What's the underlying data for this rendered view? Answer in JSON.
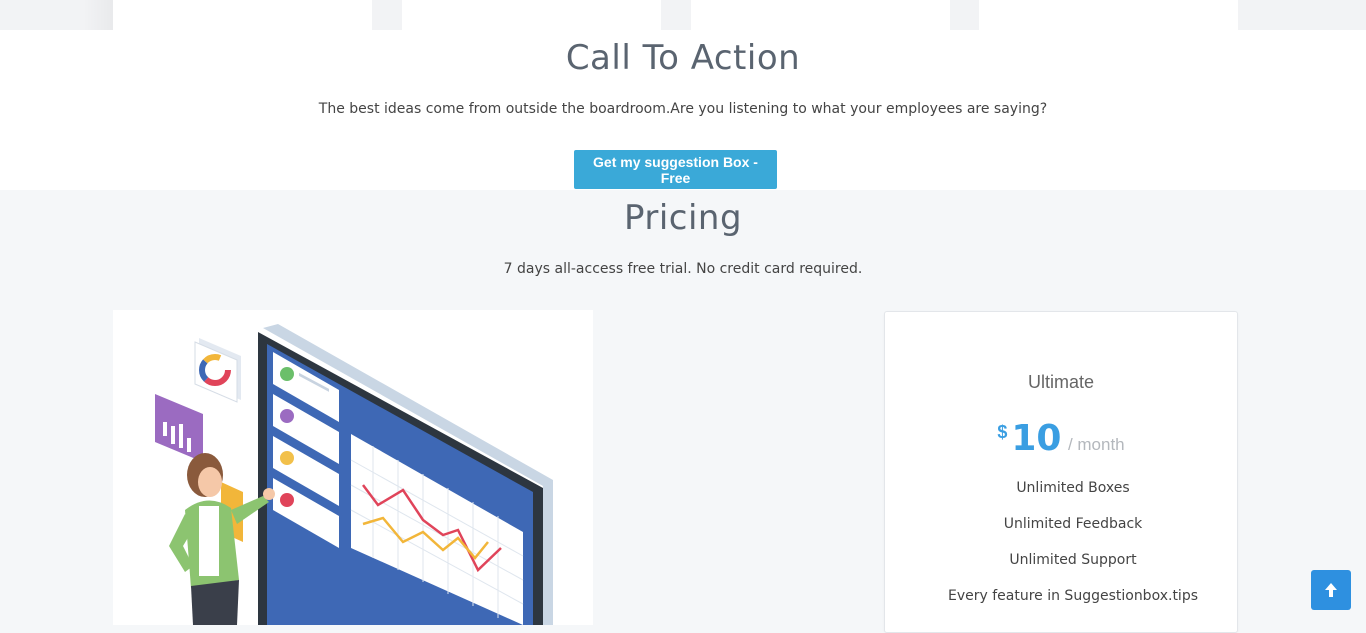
{
  "cta": {
    "title": "Call To Action",
    "text": "The best ideas come from outside the boardroom.Are you listening to what your employees are saying?",
    "button_label": "Get my suggestion Box - Free"
  },
  "pricing": {
    "title": "Pricing",
    "subtitle": "7 days all-access free trial. No credit card required."
  },
  "plan": {
    "name": "Ultimate",
    "currency": "$",
    "amount": "10",
    "period": "/ month",
    "features": [
      "Unlimited Boxes",
      "Unlimited Feedback",
      "Unlimited Support",
      "Every feature in Suggestionbox.tips"
    ]
  },
  "colors": {
    "accent": "#3aa9d8",
    "price": "#3a9ee2",
    "scroll_button": "#2e90e0"
  },
  "icons": {
    "scroll_top": "arrow-up-icon"
  }
}
